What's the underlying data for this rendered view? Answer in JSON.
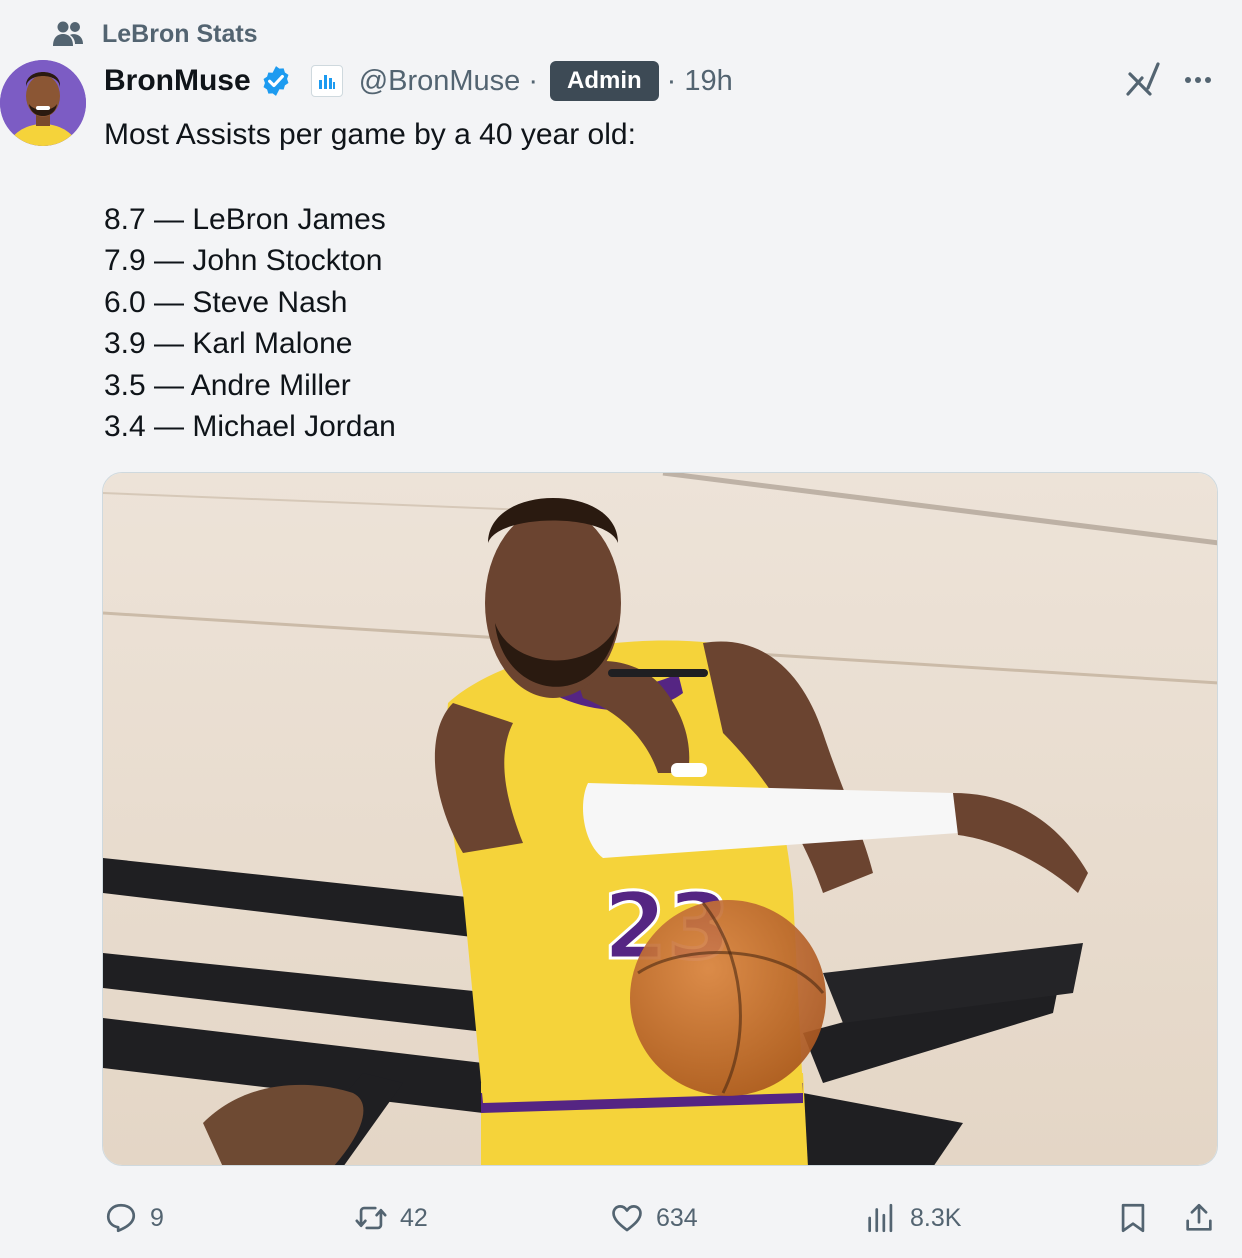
{
  "community": {
    "label": "LeBron Stats",
    "icon": "community-people-icon"
  },
  "author": {
    "display_name": "BronMuse",
    "handle": "@BronMuse",
    "separator": "·",
    "role_badge": "Admin",
    "time": "· 19h",
    "verified_color": "#1d9bf0"
  },
  "tweet": {
    "headline": "Most Assists per game by a 40 year old:",
    "list": [
      "8.7 — LeBron James",
      "7.9 — John Stockton",
      "6.0 — Steve Nash",
      "3.9 — Karl Malone",
      "3.5 — Andre Miller",
      "3.4 — Michael Jordan"
    ]
  },
  "media": {
    "jersey_number": "23",
    "colors": {
      "jersey": "#f5d33a",
      "trim": "#552583",
      "court": "#e9ddd0",
      "ball": "#c56b2e"
    }
  },
  "actions": {
    "replies": "9",
    "reposts": "42",
    "likes": "634",
    "views": "8.3K"
  },
  "colors": {
    "accent": "#1d9bf0",
    "muted": "#536471",
    "badge": "#3d4a55"
  }
}
